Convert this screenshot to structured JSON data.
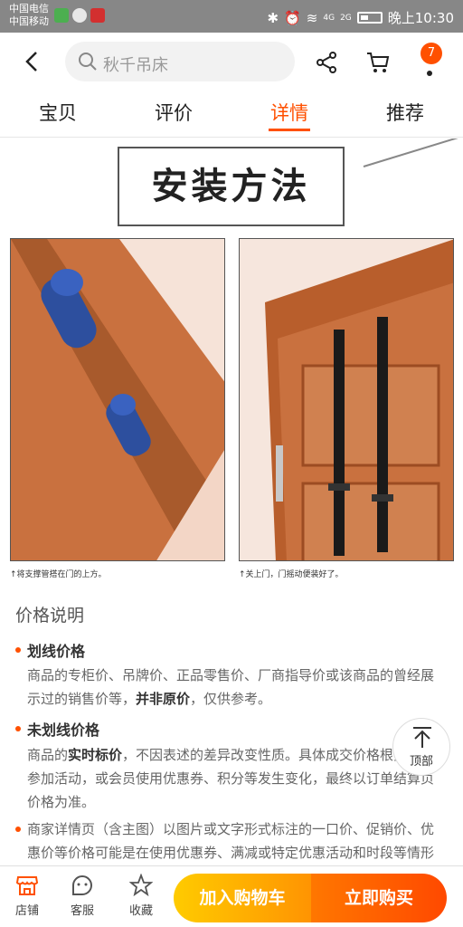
{
  "status_bar": {
    "carrier_1": "中国电信",
    "carrier_2": "中国移动",
    "signal_1": "4G",
    "signal_2": "2G",
    "time": "晚上10:30"
  },
  "nav": {
    "search_placeholder": "秋千吊床",
    "cart_badge": "7"
  },
  "tabs": [
    {
      "label": "宝贝",
      "active": false
    },
    {
      "label": "评价",
      "active": false
    },
    {
      "label": "详情",
      "active": true
    },
    {
      "label": "推荐",
      "active": false
    }
  ],
  "content": {
    "install_title": "安装方法",
    "caption_left": "↑将支撑管搭在门的上方。",
    "caption_right": "↑关上门，门摇动便装好了。",
    "price_section_title": "价格说明",
    "item1_head": "划线价格",
    "item1_text_a": "商品的专柜价、吊牌价、正品零售价、厂商指导价或该商品的曾经展示过的销售价等，",
    "item1_text_bold": "并非原价",
    "item1_text_b": "，仅供参考。",
    "item2_head": "未划线价格",
    "item2_text_a": "商品的",
    "item2_text_bold": "实时标价",
    "item2_text_b": "，不因表述的差异改变性质。具体成交价格根据商品参加活动，或会员使用优惠券、积分等发生变化，最终以订单结算页价格为准。",
    "item3_text": "商家详情页（含主图）以图片或文字形式标注的一口价、促销价、优惠价等价格可能是在使用优惠券、满减或特定优惠活动和时段等情形下的价格，具体请以结算页面的标价、优惠条件或活动规则为准。"
  },
  "to_top_label": "顶部",
  "bottom_bar": {
    "store_label": "店铺",
    "service_label": "客服",
    "fav_label": "收藏",
    "add_cart_label": "加入购物车",
    "buy_now_label": "立即购买"
  },
  "colors": {
    "accent": "#ff5000",
    "cart_button": "#ffb000",
    "buy_button": "#ff5a00"
  },
  "icons": [
    "back-icon",
    "search-icon",
    "share-icon",
    "cart-icon",
    "more-icon",
    "store-icon",
    "service-icon",
    "star-icon",
    "arrow-up-icon"
  ]
}
